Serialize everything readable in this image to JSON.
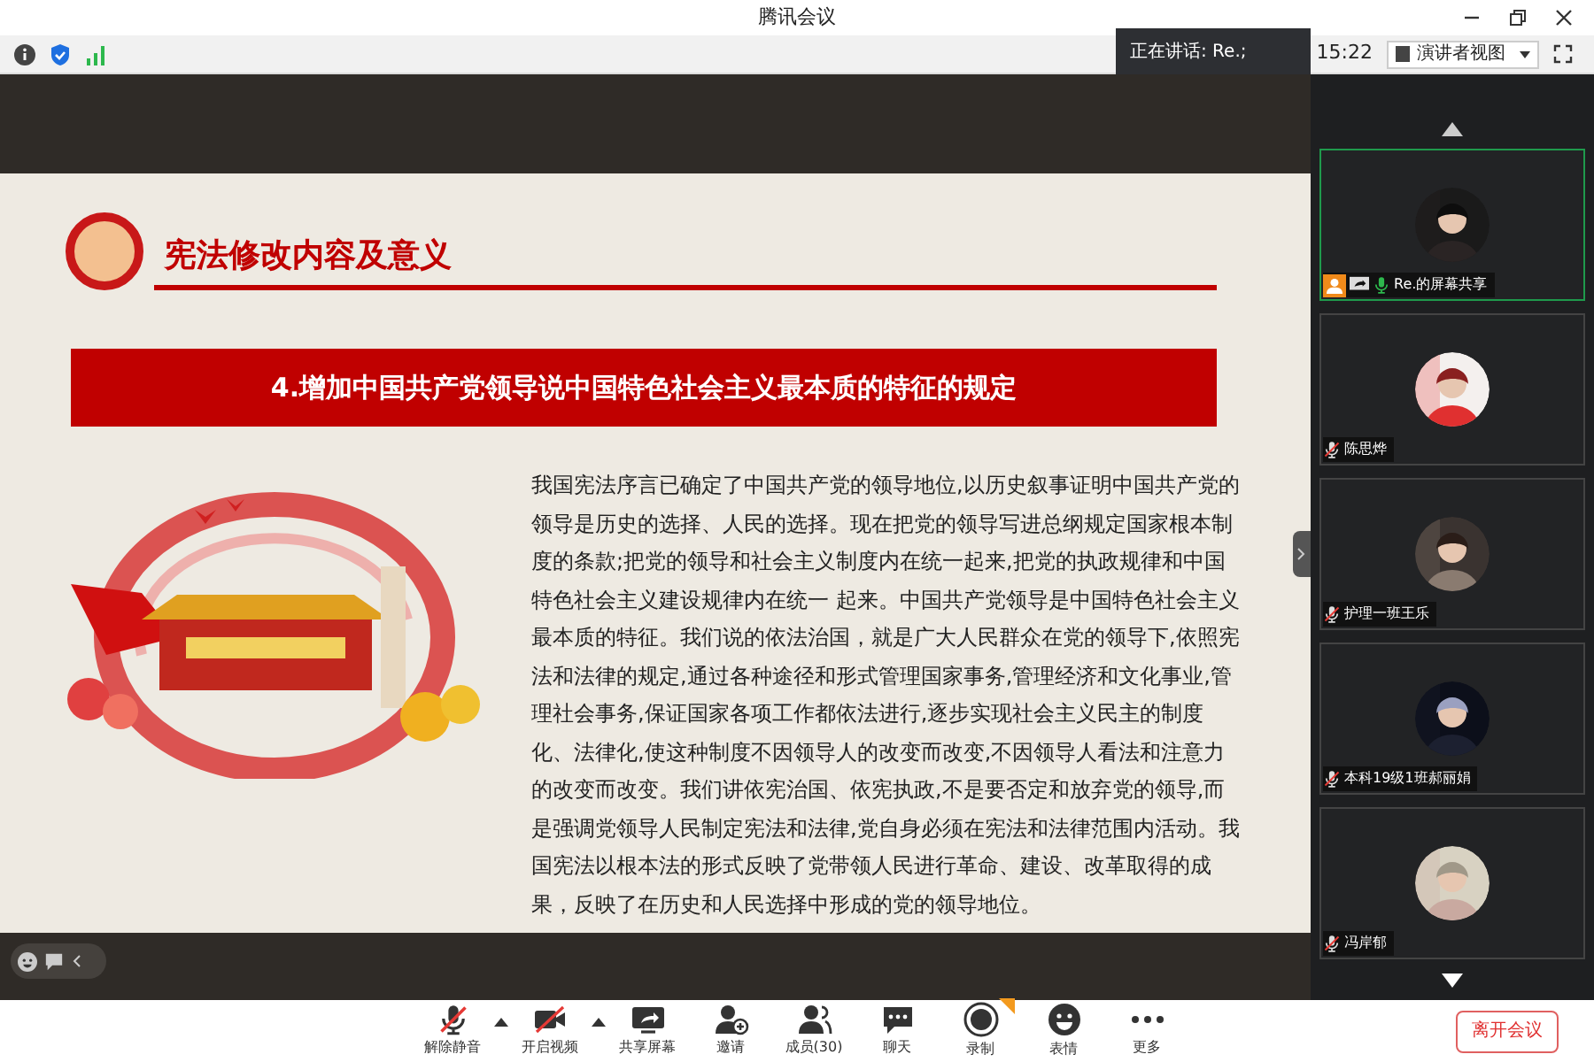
{
  "window": {
    "title": "腾讯会议"
  },
  "toolbar": {
    "speaking": "正在讲话: Re.;",
    "time": "15:22",
    "view_button": "演讲者视图"
  },
  "slide": {
    "heading": "宪法修改内容及意义",
    "banner": "4.增加中国共产党领导说中国特色社会主义最本质的特征的规定",
    "paragraph": "我国宪法序言已确定了中国共产党的领导地位,以历史叙事证明中国共产党的领导是历史的选择、人民的选择。现在把党的领导写进总纲规定国家根本制度的条款;把党的领导和社会主义制度内在统一起来,把党的执政规律和中国特色社会主义建设规律内在统一 起来。中国共产党领导是中国特色社会主义最本质的特征。我们说的依法治国，就是广大人民群众在党的领导下,依照宪法和法律的规定,通过各种途径和形式管理国家事务,管理经济和文化事业,管理社会事务,保证国家各项工作都依法进行,逐步实现社会主义民主的制度化、法律化,使这种制度不因领导人的改变而改变,不因领导人看法和注意力的改变而改变。我们讲依宪治国、依宪执政,不是要否定和放弃党的领导,而是强调党领导人民制定宪法和法律,党自身必须在宪法和法律范围内活动。我国宪法以根本法的形式反映了党带领人民进行革命、建设、改革取得的成果，反映了在历史和人民选择中形成的党的领导地位。"
  },
  "participants": [
    {
      "name": "Re.的屏幕共享",
      "host": true,
      "sharing": true,
      "muted": false,
      "selected": true
    },
    {
      "name": "陈思烨",
      "host": false,
      "sharing": false,
      "muted": true,
      "selected": false
    },
    {
      "name": "护理一班王乐",
      "host": false,
      "sharing": false,
      "muted": true,
      "selected": false
    },
    {
      "name": "本科19级1班郝丽娟",
      "host": false,
      "sharing": false,
      "muted": true,
      "selected": false
    },
    {
      "name": "冯岸郁",
      "host": false,
      "sharing": false,
      "muted": true,
      "selected": false
    }
  ],
  "bottom_bar": {
    "items": [
      {
        "label": "解除静音",
        "kind": "mic",
        "has_menu": true
      },
      {
        "label": "开启视频",
        "kind": "video",
        "has_menu": true
      },
      {
        "label": "共享屏幕",
        "kind": "share",
        "has_menu": false
      },
      {
        "label": "邀请",
        "kind": "invite",
        "has_menu": false
      },
      {
        "label": "成员(30)",
        "kind": "members",
        "has_menu": false
      },
      {
        "label": "聊天",
        "kind": "chat",
        "has_menu": false
      },
      {
        "label": "录制",
        "kind": "record",
        "has_menu": false
      },
      {
        "label": "表情",
        "kind": "emoji",
        "has_menu": false
      },
      {
        "label": "更多",
        "kind": "more",
        "has_menu": false
      }
    ],
    "leave_button": "离开会议"
  }
}
